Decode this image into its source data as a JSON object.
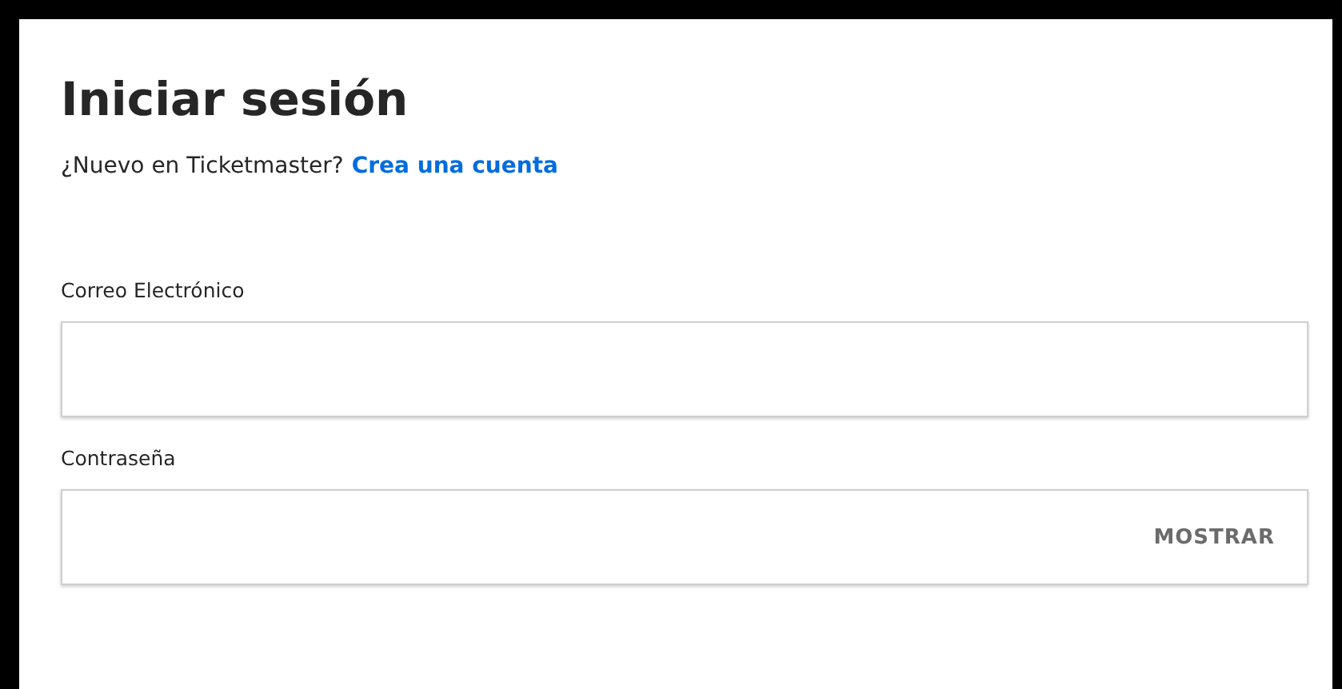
{
  "title": "Iniciar sesión",
  "signup_prompt": {
    "text": "¿Nuevo en Ticketmaster?",
    "link": "Crea una cuenta"
  },
  "fields": [
    {
      "label": "Correo Electrónico"
    },
    {
      "label": "Contraseña",
      "toggle": "MOSTRAR"
    }
  ]
}
